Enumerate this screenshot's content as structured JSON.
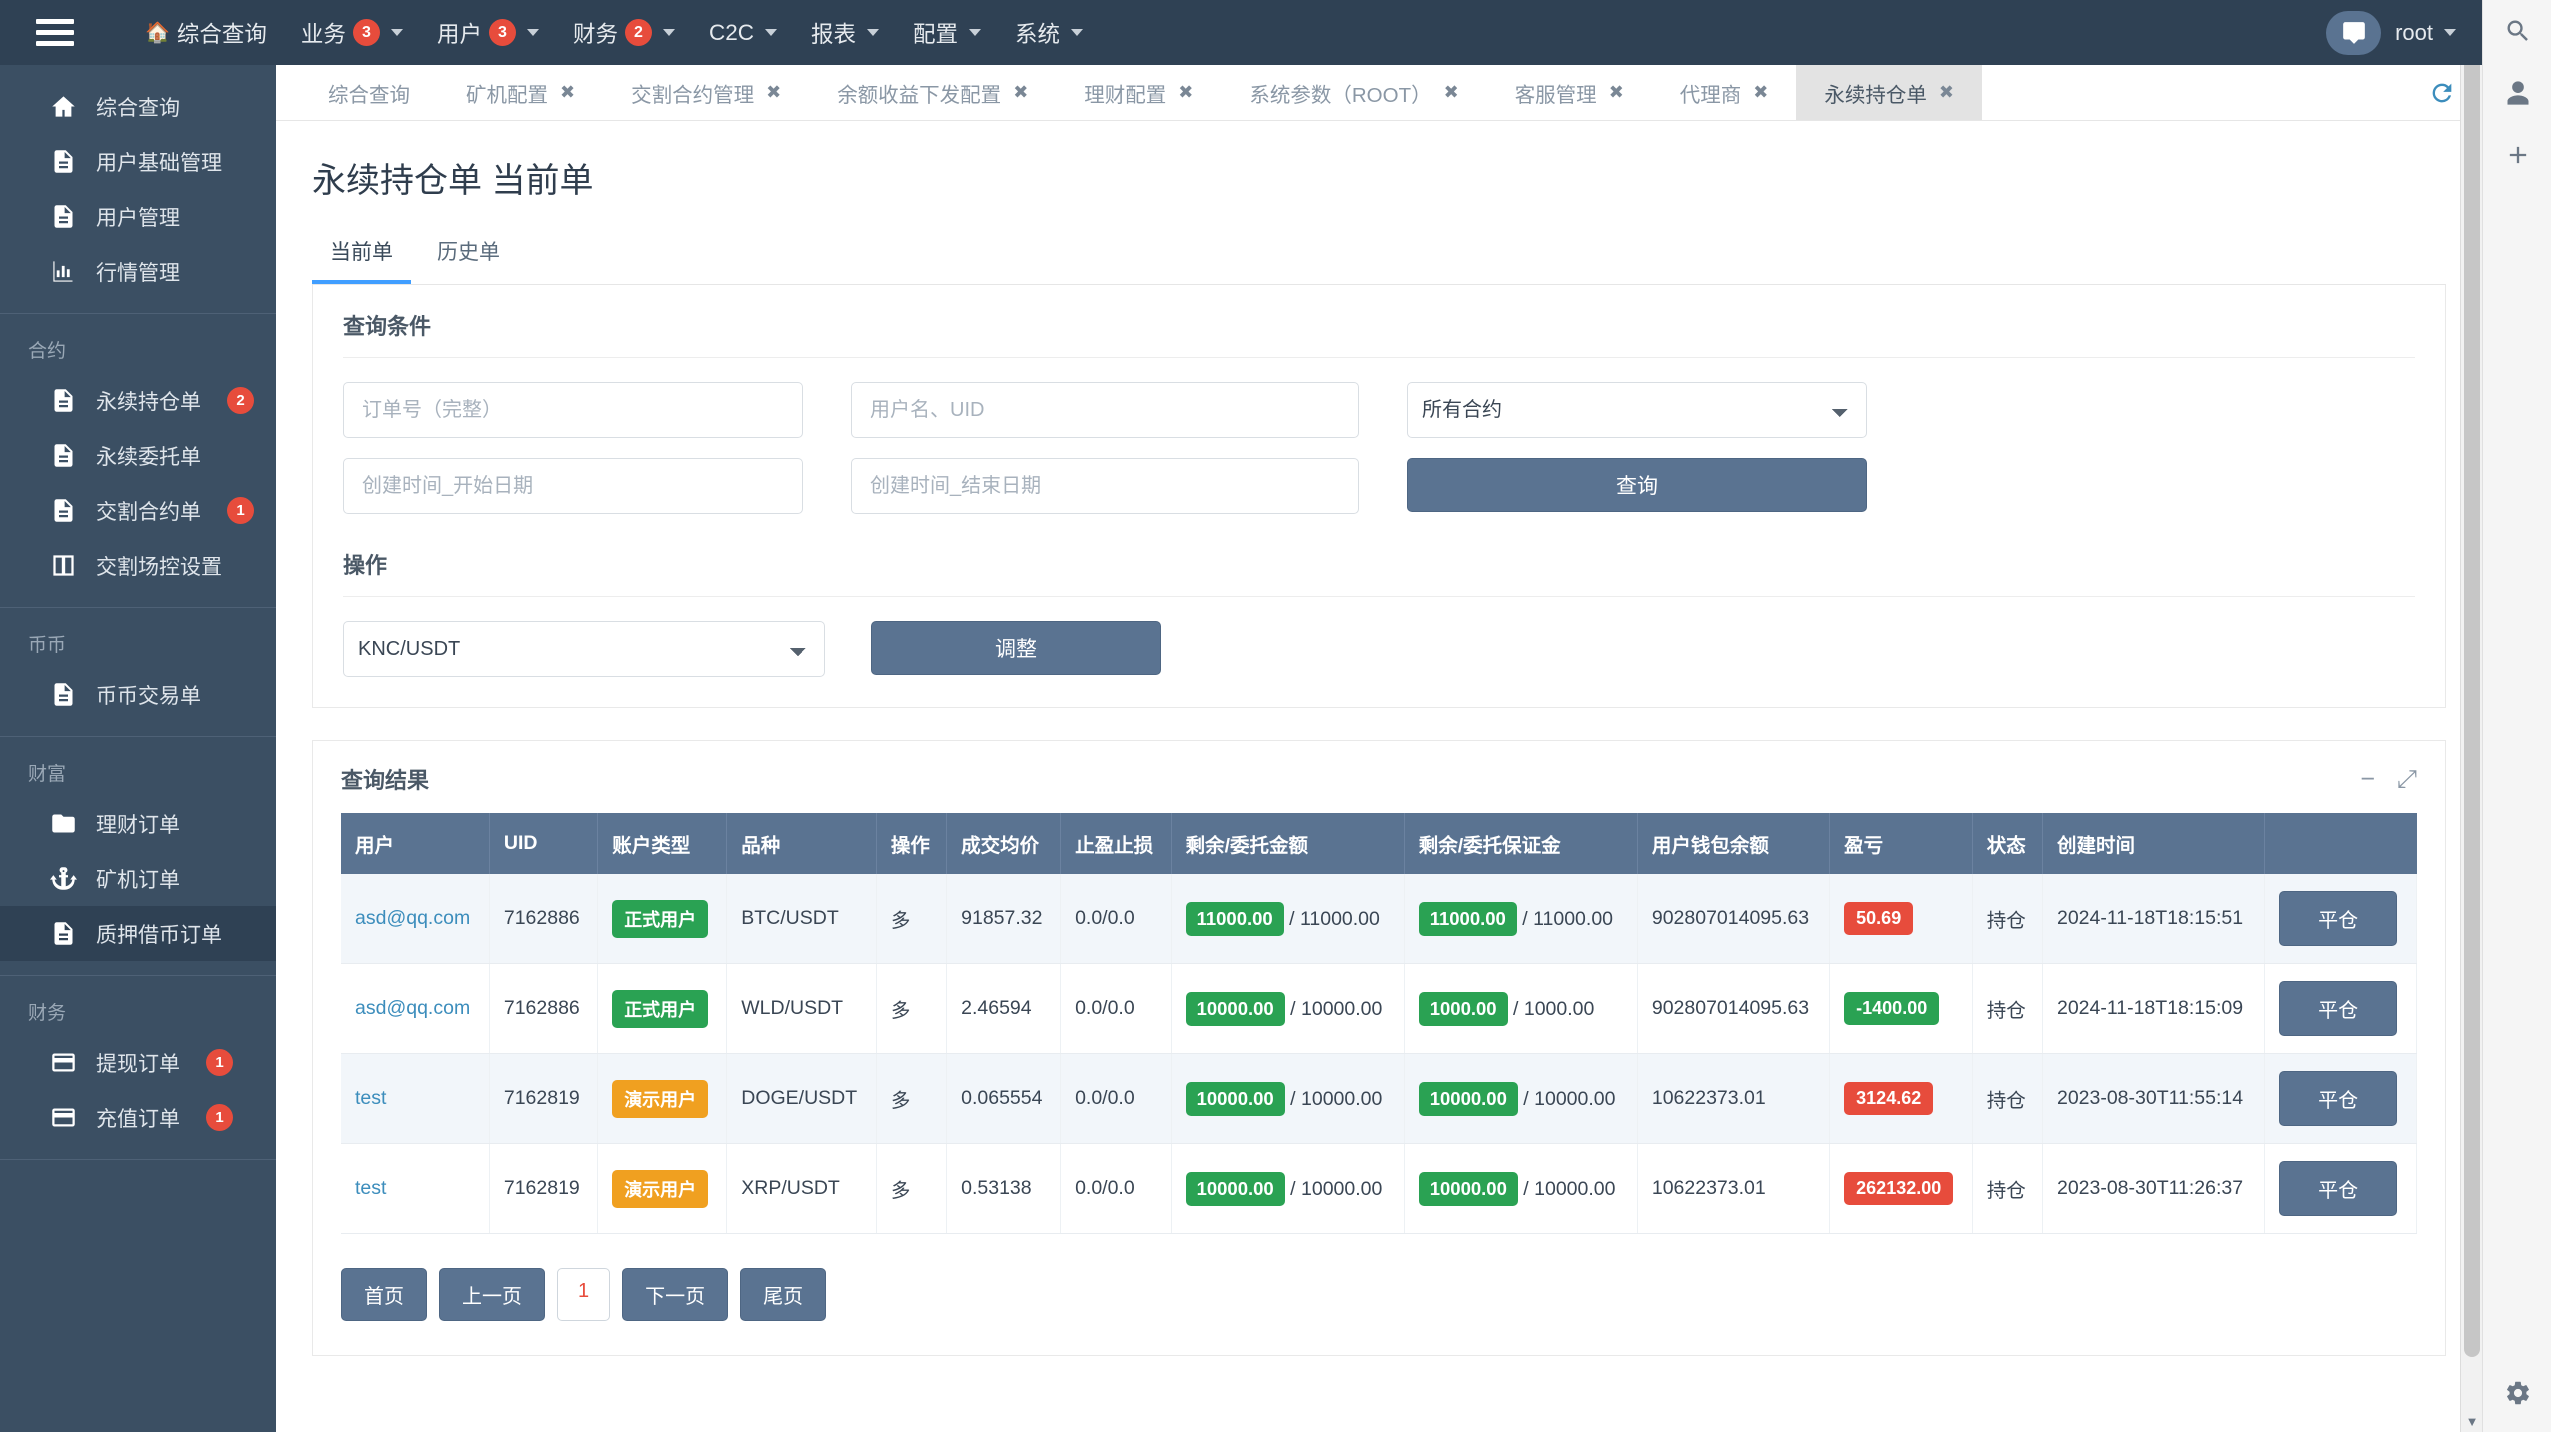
{
  "navbar": {
    "menu_icon": "hamburger-icon",
    "items": [
      {
        "label": "综合查询",
        "icon": "home-icon",
        "badge": null,
        "caret": false
      },
      {
        "label": "业务",
        "icon": null,
        "badge": "3",
        "caret": true
      },
      {
        "label": "用户",
        "icon": null,
        "badge": "3",
        "caret": true
      },
      {
        "label": "财务",
        "icon": null,
        "badge": "2",
        "caret": true
      },
      {
        "label": "C2C",
        "icon": null,
        "badge": null,
        "caret": true
      },
      {
        "label": "报表",
        "icon": null,
        "badge": null,
        "caret": true
      },
      {
        "label": "配置",
        "icon": null,
        "badge": null,
        "caret": true
      },
      {
        "label": "系统",
        "icon": null,
        "badge": null,
        "caret": true
      }
    ],
    "user": "root",
    "chat_icon": "chat-icon"
  },
  "sidebar": {
    "groups": [
      {
        "title": null,
        "items": [
          {
            "label": "综合查询",
            "icon": "home-icon",
            "badge": null,
            "active": false
          },
          {
            "label": "用户基础管理",
            "icon": "file-icon",
            "badge": null,
            "active": false
          },
          {
            "label": "用户管理",
            "icon": "file-icon",
            "badge": null,
            "active": false
          },
          {
            "label": "行情管理",
            "icon": "chart-icon",
            "badge": null,
            "active": false
          }
        ]
      },
      {
        "title": "合约",
        "items": [
          {
            "label": "永续持仓单",
            "icon": "file-icon",
            "badge": "2",
            "active": false
          },
          {
            "label": "永续委托单",
            "icon": "file-icon",
            "badge": null,
            "active": false
          },
          {
            "label": "交割合约单",
            "icon": "file-icon",
            "badge": "1",
            "active": false
          },
          {
            "label": "交割场控设置",
            "icon": "columns-icon",
            "badge": null,
            "active": false
          }
        ]
      },
      {
        "title": "币币",
        "items": [
          {
            "label": "币币交易单",
            "icon": "file-icon",
            "badge": null,
            "active": false
          }
        ]
      },
      {
        "title": "财富",
        "items": [
          {
            "label": "理财订单",
            "icon": "folder-icon",
            "badge": null,
            "active": false
          },
          {
            "label": "矿机订单",
            "icon": "anchor-icon",
            "badge": null,
            "active": false
          },
          {
            "label": "质押借币订单",
            "icon": "file-icon",
            "badge": null,
            "active": true
          }
        ]
      },
      {
        "title": "财务",
        "items": [
          {
            "label": "提现订单",
            "icon": "card-icon",
            "badge": "1",
            "active": false
          },
          {
            "label": "充值订单",
            "icon": "card-icon",
            "badge": "1",
            "active": false
          }
        ]
      }
    ]
  },
  "tabbar": {
    "tabs": [
      {
        "label": "综合查询",
        "closable": false,
        "active": false
      },
      {
        "label": "矿机配置",
        "closable": true,
        "active": false
      },
      {
        "label": "交割合约管理",
        "closable": true,
        "active": false
      },
      {
        "label": "余额收益下发配置",
        "closable": true,
        "active": false
      },
      {
        "label": "理财配置",
        "closable": true,
        "active": false
      },
      {
        "label": "系统参数（ROOT）",
        "closable": true,
        "active": false
      },
      {
        "label": "客服管理",
        "closable": true,
        "active": false
      },
      {
        "label": "代理商",
        "closable": true,
        "active": false
      },
      {
        "label": "永续持仓单",
        "closable": true,
        "active": true
      }
    ],
    "close_glyph": "✖",
    "refresh_icon": "refresh-icon"
  },
  "page": {
    "title": "永续持仓单 当前单",
    "subtabs": [
      {
        "label": "当前单",
        "active": true
      },
      {
        "label": "历史单",
        "active": false
      }
    ]
  },
  "query_panel": {
    "title": "查询条件",
    "order_no_placeholder": "订单号（完整）",
    "order_no_value": "",
    "user_placeholder": "用户名、UID",
    "user_value": "",
    "contract_select": "所有合约",
    "start_date_placeholder": "创建时间_开始日期",
    "start_date_value": "",
    "end_date_placeholder": "创建时间_结束日期",
    "end_date_value": "",
    "query_button": "查询"
  },
  "operation_panel": {
    "title": "操作",
    "symbol_select": "KNC/USDT",
    "adjust_button": "调整"
  },
  "results": {
    "title": "查询结果",
    "minimize_glyph": "−",
    "expand_glyph": "⤢",
    "columns": [
      "用户",
      "UID",
      "账户类型",
      "品种",
      "操作",
      "成交均价",
      "止盈止损",
      "剩余/委托金额",
      "剩余/委托保证金",
      "用户钱包余额",
      "盈亏",
      "状态",
      "创建时间",
      ""
    ],
    "rows": [
      {
        "user": "asd@qq.com",
        "uid": "7162886",
        "account_type": "正式用户",
        "account_type_color": "green",
        "symbol": "BTC/USDT",
        "direction": "多",
        "avg_price": "91857.32",
        "tp_sl": "0.0/0.0",
        "amount_left": "11000.00",
        "amount_total": "11000.00",
        "margin_left": "11000.00",
        "margin_total": "11000.00",
        "wallet_balance": "902807014095.63",
        "pnl": "50.69",
        "pnl_color": "red",
        "status": "持仓",
        "created_at": "2024-11-18T18:15:51",
        "action": "平仓"
      },
      {
        "user": "asd@qq.com",
        "uid": "7162886",
        "account_type": "正式用户",
        "account_type_color": "green",
        "symbol": "WLD/USDT",
        "direction": "多",
        "avg_price": "2.46594",
        "tp_sl": "0.0/0.0",
        "amount_left": "10000.00",
        "amount_total": "10000.00",
        "margin_left": "1000.00",
        "margin_total": "1000.00",
        "wallet_balance": "902807014095.63",
        "pnl": "-1400.00",
        "pnl_color": "green",
        "status": "持仓",
        "created_at": "2024-11-18T18:15:09",
        "action": "平仓"
      },
      {
        "user": "test",
        "uid": "7162819",
        "account_type": "演示用户",
        "account_type_color": "orange",
        "symbol": "DOGE/USDT",
        "direction": "多",
        "avg_price": "0.065554",
        "tp_sl": "0.0/0.0",
        "amount_left": "10000.00",
        "amount_total": "10000.00",
        "margin_left": "10000.00",
        "margin_total": "10000.00",
        "wallet_balance": "10622373.01",
        "pnl": "3124.62",
        "pnl_color": "red",
        "status": "持仓",
        "created_at": "2023-08-30T11:55:14",
        "action": "平仓"
      },
      {
        "user": "test",
        "uid": "7162819",
        "account_type": "演示用户",
        "account_type_color": "orange",
        "symbol": "XRP/USDT",
        "direction": "多",
        "avg_price": "0.53138",
        "tp_sl": "0.0/0.0",
        "amount_left": "10000.00",
        "amount_total": "10000.00",
        "margin_left": "10000.00",
        "margin_total": "10000.00",
        "wallet_balance": "10622373.01",
        "pnl": "262132.00",
        "pnl_color": "red",
        "status": "持仓",
        "created_at": "2023-08-30T11:26:37",
        "action": "平仓"
      }
    ],
    "pager": {
      "first": "首页",
      "prev": "上一页",
      "current": "1",
      "next": "下一页",
      "last": "尾页"
    }
  },
  "colors": {
    "navbar_bg": "#2f4154",
    "sidebar_bg": "#3b4f63",
    "accent_blue": "#409eff",
    "link_blue": "#3c8dbc",
    "success_green": "#2aa253",
    "warning_orange": "#f0a020",
    "danger_red": "#e74c3c",
    "button_slate": "#5a7391"
  }
}
